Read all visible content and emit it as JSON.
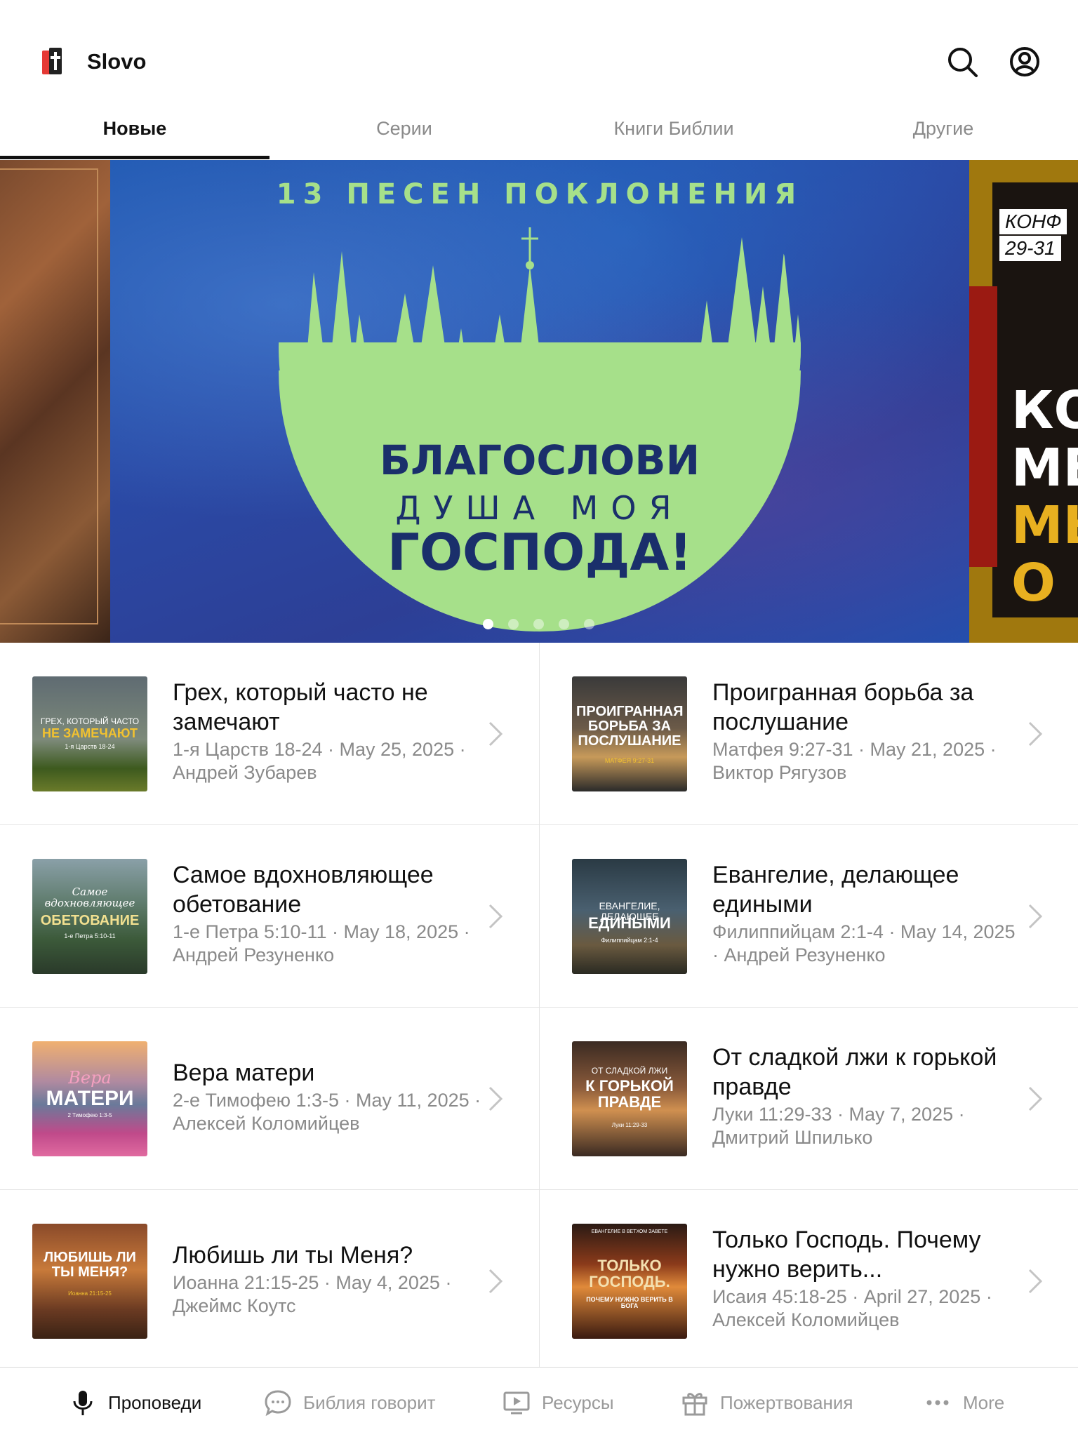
{
  "app": {
    "title": "Slovo"
  },
  "tabs": [
    {
      "label": "Новые",
      "active": true
    },
    {
      "label": "Серии",
      "active": false
    },
    {
      "label": "Книги Библии",
      "active": false
    },
    {
      "label": "Другие",
      "active": false
    }
  ],
  "banner": {
    "main": {
      "top_line": "13 ПЕСЕН ПОКЛОНЕНИЯ",
      "line1": "БЛАГОСЛОВИ",
      "line2": "ДУША МОЯ",
      "line3": "ГОСПОДА!"
    },
    "right": {
      "tag1": "КОНФ",
      "tag2": "29-31",
      "big1": "КОГ",
      "big2": "МЕН",
      "big3": "МЫ",
      "big4": "О Н"
    },
    "dots_count": 5,
    "active_dot": 0
  },
  "sermons": [
    {
      "title": "Грех, который часто не замечают",
      "meta": "1-я Царств 18-24 · May 25, 2025 · Андрей Зубарев",
      "thumb": {
        "small": "ГРЕХ, КОТОРЫЙ ЧАСТО",
        "big": "НЕ ЗАМЕЧАЮТ",
        "ref": "1-я Царств 18-24"
      }
    },
    {
      "title": "Проигранная борьба за послушание",
      "meta": "Матфея 9:27-31 · May 21, 2025 · Виктор Рягузов",
      "thumb": {
        "small": "",
        "big": "ПРОИГРАННАЯ БОРЬБА ЗА ПОСЛУШАНИЕ",
        "ref": "МАТФЕЯ 9:27-31"
      }
    },
    {
      "title": "Самое вдохновляющее обетование",
      "meta": "1-е Петра 5:10-11 · May 18, 2025 · Андрей Резуненко",
      "thumb": {
        "small": "Самое вдохновляющее",
        "big": "ОБЕТОВАНИЕ",
        "ref": "1-е Петра 5:10-11"
      }
    },
    {
      "title": "Евангелие, делающее едиными",
      "meta": "Филиппийцам 2:1-4 · May 14, 2025 · Андрей Резуненко",
      "thumb": {
        "small": "ЕВАНГЕЛИЕ, ДЕЛАЮЩЕЕ",
        "big": "ЕДИНЫМИ",
        "ref": "Филиппийцам 2:1-4"
      }
    },
    {
      "title": "Вера матери",
      "meta": "2-е Тимофею 1:3-5 · May 11, 2025 · Алексей Коломийцев",
      "thumb": {
        "small": "Вера",
        "big": "МАТЕРИ",
        "ref": "2 Тимофею 1:3-5"
      }
    },
    {
      "title": "От сладкой лжи к горькой правде",
      "meta": "Луки 11:29-33 · May 7, 2025 · Дмитрий Шпилько",
      "thumb": {
        "small": "ОТ СЛАДКОЙ ЛЖИ",
        "big": "К ГОРЬКОЙ ПРАВДЕ",
        "ref": "Луки 11:29-33"
      }
    },
    {
      "title": "Любишь ли ты Меня?",
      "meta": "Иоанна 21:15-25 · May 4, 2025 · Джеймс Коутс",
      "thumb": {
        "small": "",
        "big": "ЛЮБИШЬ ЛИ ТЫ МЕНЯ?",
        "ref": "Иоанна 21:15-25"
      }
    },
    {
      "title": "Только Господь. Почему нужно верить...",
      "meta": "Исаия 45:18-25 · April 27, 2025 · Алексей Коломийцев",
      "thumb": {
        "small": "ЕВАНГЕЛИЕ В ВЕТХОМ ЗАВЕТЕ",
        "big": "ТОЛЬКО ГОСПОДЬ.",
        "ref": "ПОЧЕМУ НУЖНО ВЕРИТЬ В БОГА"
      }
    }
  ],
  "bottom_nav": [
    {
      "label": "Проповеди",
      "icon": "microphone-icon",
      "active": true
    },
    {
      "label": "Библия говорит",
      "icon": "chat-bubble-icon",
      "active": false
    },
    {
      "label": "Ресурсы",
      "icon": "video-screen-icon",
      "active": false
    },
    {
      "label": "Пожертвования",
      "icon": "gift-icon",
      "active": false
    },
    {
      "label": "More",
      "icon": "more-dots-icon",
      "active": false
    }
  ],
  "colors": {
    "accent_logo_red": "#e53935",
    "banner_green": "#a6e08a",
    "banner_navy_text": "#1a2f6b",
    "muted_text": "#8a8a8a"
  }
}
